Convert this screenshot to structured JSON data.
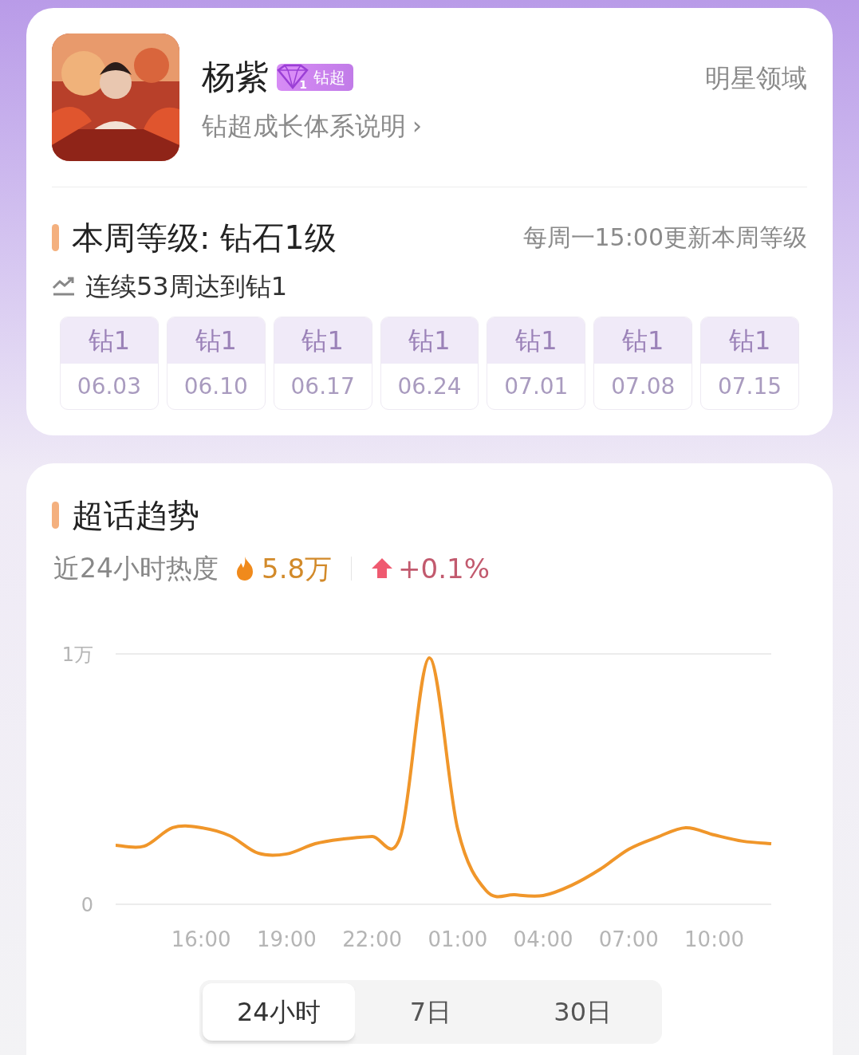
{
  "profile": {
    "name": "杨紫",
    "badge": {
      "level": "1",
      "label": "钻超"
    },
    "link": {
      "label": "钻超成长体系说明",
      "chevron": "›"
    },
    "domain": "明星领域"
  },
  "level": {
    "title": "本周等级: 钻石1级",
    "note": "每周一15:00更新本周等级",
    "streak": "连续53周达到钻1",
    "weeks": [
      {
        "grade": "钻1",
        "date": "06.03"
      },
      {
        "grade": "钻1",
        "date": "06.10"
      },
      {
        "grade": "钻1",
        "date": "06.17"
      },
      {
        "grade": "钻1",
        "date": "06.24"
      },
      {
        "grade": "钻1",
        "date": "07.01"
      },
      {
        "grade": "钻1",
        "date": "07.08"
      },
      {
        "grade": "钻1",
        "date": "07.15"
      }
    ]
  },
  "trend": {
    "title": "超话趋势",
    "heat_label": "近24小时热度",
    "heat_value": "5.8万",
    "change": "+0.1%",
    "chart_data": {
      "type": "line",
      "categories": [
        null,
        null,
        null,
        "16:00",
        null,
        null,
        "19:00",
        null,
        null,
        "22:00",
        null,
        null,
        "01:00",
        null,
        null,
        "04:00",
        null,
        null,
        "07:00",
        null,
        null,
        "10:00",
        null,
        null
      ],
      "series": [
        {
          "color": "#f0962a",
          "values": [
            0.236,
            0.232,
            0.306,
            0.306,
            0.274,
            0.204,
            0.201,
            0.242,
            0.261,
            0.271,
            0.274,
            0.984,
            0.3,
            0.054,
            0.038,
            0.035,
            0.076,
            0.14,
            0.22,
            0.268,
            0.306,
            0.277,
            0.252,
            0.242
          ]
        }
      ],
      "ylim": [
        0,
        1
      ],
      "yticks": [
        0,
        {
          "value": 1,
          "label": "1万"
        }
      ]
    },
    "ranges": [
      {
        "label": "24小时",
        "selected": true
      },
      {
        "label": "7日",
        "selected": false
      },
      {
        "label": "30日",
        "selected": false
      }
    ]
  }
}
